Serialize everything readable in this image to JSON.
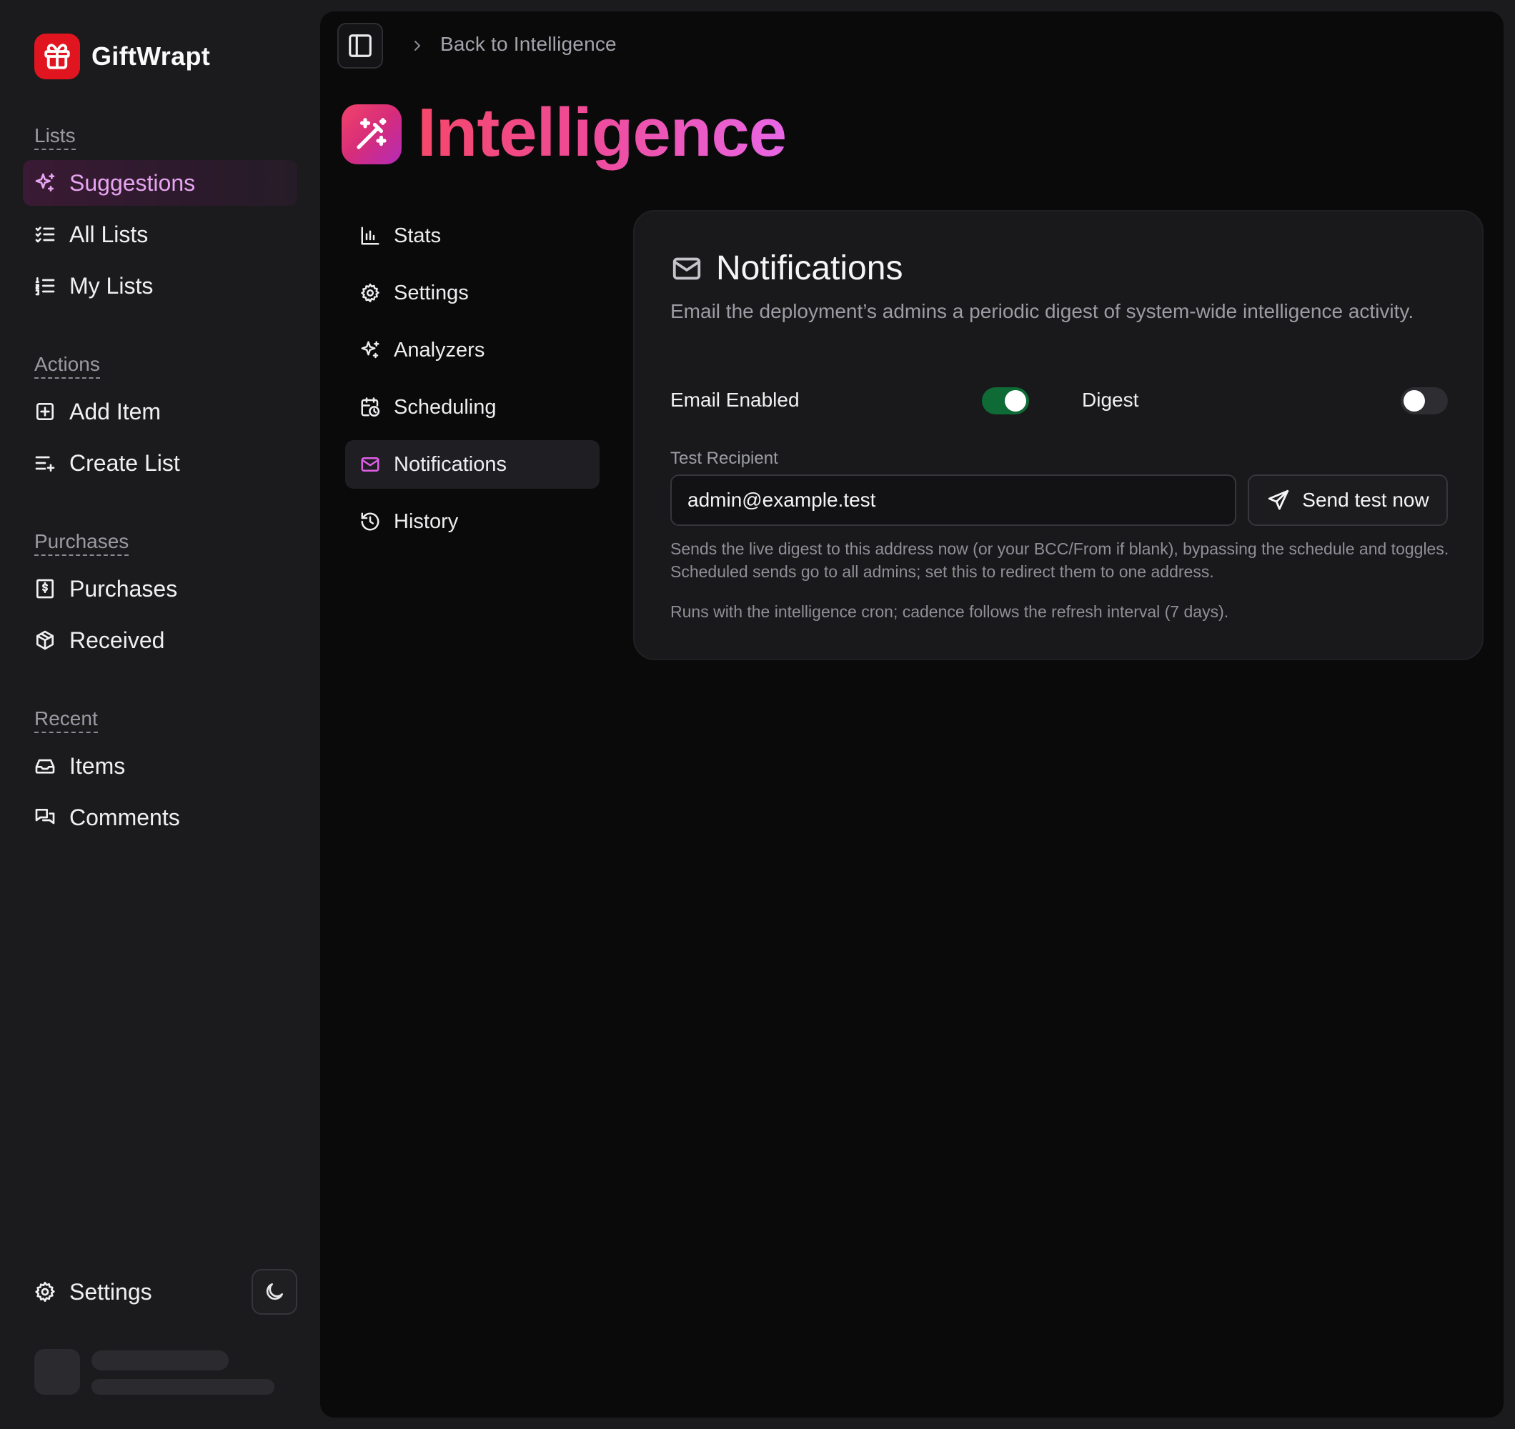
{
  "brand": {
    "name": "GiftWrapt"
  },
  "sidebar": {
    "groups": [
      {
        "label": "Lists",
        "items": [
          {
            "label": "Suggestions",
            "icon": "sparkles-icon",
            "active": true
          },
          {
            "label": "All Lists",
            "icon": "list-checks-icon"
          },
          {
            "label": "My Lists",
            "icon": "list-ordered-icon"
          }
        ]
      },
      {
        "label": "Actions",
        "items": [
          {
            "label": "Add Item",
            "icon": "plus-square-icon"
          },
          {
            "label": "Create List",
            "icon": "list-plus-icon"
          }
        ]
      },
      {
        "label": "Purchases",
        "items": [
          {
            "label": "Purchases",
            "icon": "receipt-icon"
          },
          {
            "label": "Received",
            "icon": "package-icon"
          }
        ]
      },
      {
        "label": "Recent",
        "items": [
          {
            "label": "Items",
            "icon": "inbox-icon"
          },
          {
            "label": "Comments",
            "icon": "messages-icon"
          }
        ]
      }
    ],
    "settings_label": "Settings",
    "accent_active": "#e7a4f0"
  },
  "breadcrumb": {
    "back_label": "Back to Intelligence"
  },
  "page": {
    "title": "Intelligence"
  },
  "subnav": {
    "items": [
      {
        "label": "Stats",
        "icon": "bar-chart-icon"
      },
      {
        "label": "Settings",
        "icon": "gear-icon"
      },
      {
        "label": "Analyzers",
        "icon": "sparkles-icon"
      },
      {
        "label": "Scheduling",
        "icon": "calendar-clock-icon"
      },
      {
        "label": "Notifications",
        "icon": "mail-icon",
        "active": true
      },
      {
        "label": "History",
        "icon": "history-icon"
      }
    ]
  },
  "notifications": {
    "title": "Notifications",
    "description": "Email the deployment’s admins a periodic digest of system-wide intelligence activity.",
    "email_enabled_label": "Email Enabled",
    "email_enabled": true,
    "digest_label": "Digest",
    "digest_enabled": false,
    "test_recipient_label": "Test Recipient",
    "test_recipient_value": "admin@example.test",
    "send_test_label": "Send test now",
    "help_text": "Sends the live digest to this address now (or your BCC/From if blank), bypassing the schedule and toggles. Scheduled sends go to all admins; set this to redirect them to one address.",
    "footer_note": "Runs with the intelligence cron; cadence follows the refresh interval (7 days).",
    "toggle_on_color": "#0f6b35"
  }
}
